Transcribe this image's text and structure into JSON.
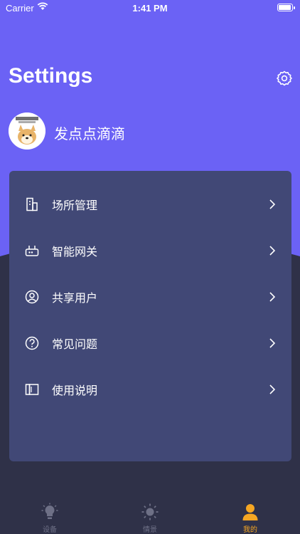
{
  "status_bar": {
    "carrier": "Carrier",
    "time": "1:41 PM"
  },
  "header": {
    "title": "Settings",
    "settings_icon": "gear-icon"
  },
  "profile": {
    "name": "发点点滴滴",
    "avatar_icon": "dog-avatar"
  },
  "menu": {
    "items": [
      {
        "label": "场所管理",
        "icon": "building-icon"
      },
      {
        "label": "智能网关",
        "icon": "gateway-icon"
      },
      {
        "label": "共享用户",
        "icon": "user-circle-icon"
      },
      {
        "label": "常见问题",
        "icon": "question-icon"
      },
      {
        "label": "使用说明",
        "icon": "book-icon"
      }
    ]
  },
  "tabbar": {
    "tabs": [
      {
        "label": "设备",
        "icon": "lightbulb-icon",
        "active": false
      },
      {
        "label": "情景",
        "icon": "sun-icon",
        "active": false
      },
      {
        "label": "我的",
        "icon": "person-icon",
        "active": true
      }
    ]
  },
  "colors": {
    "header_bg": "#6b62f5",
    "body_bg": "#2f3148",
    "card_bg": "#414876",
    "active_tab": "#f5a623",
    "inactive_tab": "#6e7086"
  }
}
